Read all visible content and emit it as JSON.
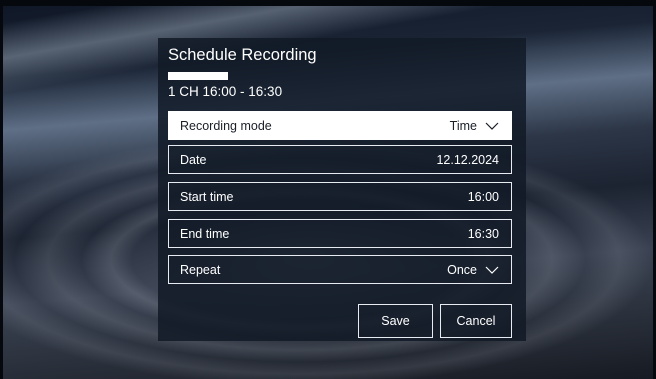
{
  "dialog": {
    "title": "Schedule Recording",
    "subtitle": "1 CH 16:00 - 16:30"
  },
  "fields": [
    {
      "label": "Recording mode",
      "value": "Time",
      "dropdown": true,
      "focused": true
    },
    {
      "label": "Date",
      "value": "12.12.2024"
    },
    {
      "label": "Start time",
      "value": "16:00"
    },
    {
      "label": "End time",
      "value": "16:30"
    },
    {
      "label": "Repeat",
      "value": "Once",
      "dropdown": true
    }
  ],
  "buttons": {
    "save_label": "Save",
    "cancel_label": "Cancel"
  },
  "icons": {
    "dropdown": "chevron-down-icon"
  },
  "colors": {
    "focus_background": "#ffffff",
    "focus_text": "#1a1f28",
    "dialog_background": "#121a26"
  }
}
